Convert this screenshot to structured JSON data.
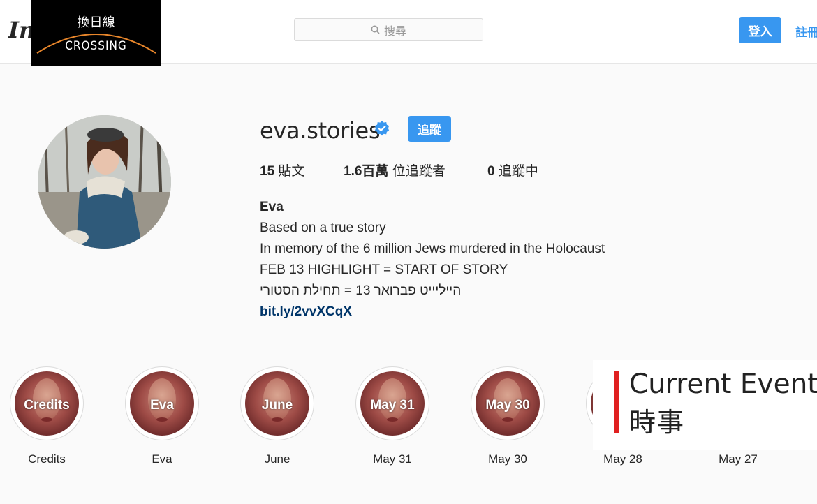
{
  "header": {
    "app_logo": "In",
    "search_placeholder": "搜尋",
    "login_label": "登入",
    "signup_label": "註冊"
  },
  "watermark": {
    "chinese": "換日線",
    "english": "CROSSING"
  },
  "profile": {
    "username": "eva.stories",
    "follow_label": "追蹤",
    "posts_count": "15",
    "posts_label": "貼文",
    "followers_count": "1.6百萬",
    "followers_label": "位追蹤者",
    "following_count": "0",
    "following_label": "追蹤中",
    "bio_name": "Eva",
    "bio_lines": [
      "Based on a true story",
      "In memory of the 6 million Jews murdered in the Holocaust",
      "FEB 13 HIGHLIGHT = START OF STORY",
      "הייליייט פברואר 13 = תחילת הסטורי"
    ],
    "bio_link": "bit.ly/2vvXCqX"
  },
  "highlights": [
    {
      "cover_text": "Credits",
      "label": "Credits"
    },
    {
      "cover_text": "Eva",
      "label": "Eva"
    },
    {
      "cover_text": "June",
      "label": "June"
    },
    {
      "cover_text": "May 31",
      "label": "May 31"
    },
    {
      "cover_text": "May 30",
      "label": "May 30"
    },
    {
      "cover_text": "",
      "label": "May 28"
    },
    {
      "cover_text": "",
      "label": "May 27"
    }
  ],
  "overlay": {
    "title_en": "Current Event",
    "title_zh": "時事"
  },
  "colors": {
    "accent_blue": "#3897f0",
    "link_blue": "#003569",
    "overlay_red": "#e02020"
  }
}
